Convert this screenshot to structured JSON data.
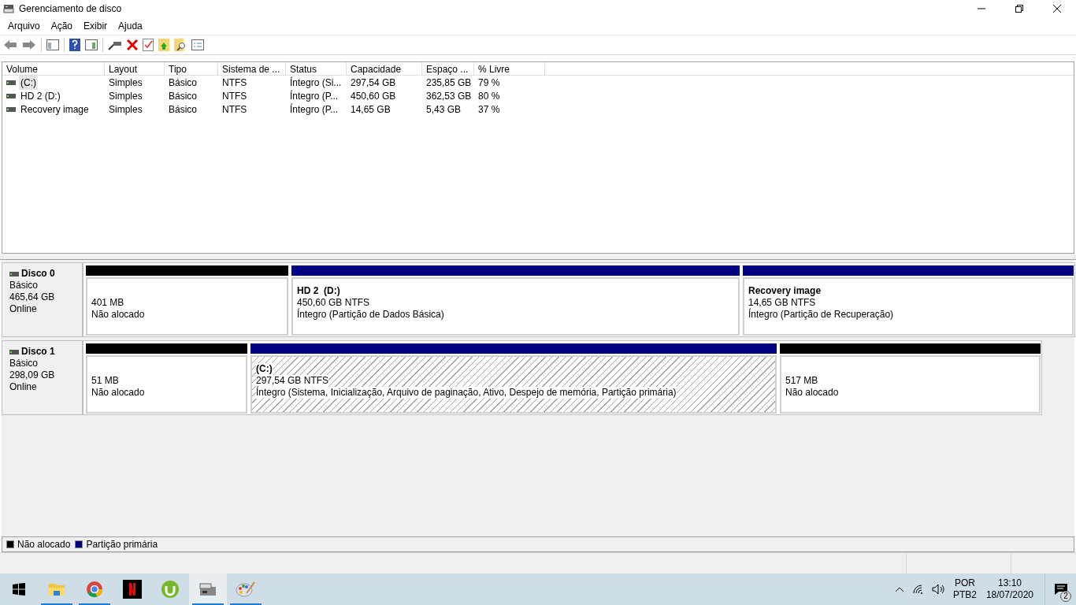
{
  "window": {
    "title": "Gerenciamento de disco"
  },
  "menu": [
    "Arquivo",
    "Ação",
    "Exibir",
    "Ajuda"
  ],
  "table": {
    "columns": [
      "Volume",
      "Layout",
      "Tipo",
      "Sistema de ...",
      "Status",
      "Capacidade",
      "Espaço ...",
      "% Livre"
    ],
    "rows": [
      {
        "selected": true,
        "cells": [
          "(C:)",
          "Simples",
          "Básico",
          "NTFS",
          "Íntegro (Si...",
          "297,54 GB",
          "235,85 GB",
          "79 %"
        ]
      },
      {
        "selected": false,
        "cells": [
          "HD 2 (D:)",
          "Simples",
          "Básico",
          "NTFS",
          "Íntegro (P...",
          "450,60 GB",
          "362,53 GB",
          "80 %"
        ]
      },
      {
        "selected": false,
        "cells": [
          "Recovery image",
          "Simples",
          "Básico",
          "NTFS",
          "Íntegro (P...",
          "14,65 GB",
          "5,43 GB",
          "37 %"
        ]
      }
    ]
  },
  "disks": [
    {
      "name": "Disco 0",
      "type": "Básico",
      "size": "465,64 GB",
      "state": "Online",
      "partitions": [
        {
          "kind": "unallocated",
          "selected": false,
          "size": "401 MB",
          "status": "Não alocado"
        },
        {
          "kind": "primary",
          "selected": false,
          "title": "HD 2  (D:)",
          "size": "450,60 GB NTFS",
          "status": "Íntegro (Partição de Dados Básica)"
        },
        {
          "kind": "primary",
          "selected": false,
          "title": "Recovery image",
          "size": "14,65 GB NTFS",
          "status": "Íntegro (Partição de Recuperação)"
        }
      ]
    },
    {
      "name": "Disco 1",
      "type": "Básico",
      "size": "298,09 GB",
      "state": "Online",
      "partitions": [
        {
          "kind": "unallocated",
          "selected": false,
          "size": "51 MB",
          "status": "Não alocado"
        },
        {
          "kind": "primary",
          "selected": true,
          "title": "(C:)",
          "size": "297,54 GB NTFS",
          "status": "Íntegro (Sistema, Inicialização, Arquivo de paginação, Ativo, Despejo de memória, Partição primária)"
        },
        {
          "kind": "unallocated",
          "selected": false,
          "size": "517 MB",
          "status": "Não alocado"
        }
      ]
    }
  ],
  "legend": [
    {
      "kind": "unallocated",
      "label": "Não alocado"
    },
    {
      "kind": "primary",
      "label": "Partição primária"
    }
  ],
  "taskbar": {
    "apps": [
      {
        "kind": "folder",
        "running": true,
        "active": false
      },
      {
        "kind": "browser",
        "running": true,
        "active": false
      },
      {
        "kind": "video",
        "running": false,
        "active": false
      },
      {
        "kind": "torrent",
        "running": false,
        "active": false
      },
      {
        "kind": "disk",
        "running": true,
        "active": true
      },
      {
        "kind": "paint",
        "running": true,
        "active": false
      }
    ],
    "language": [
      "POR",
      "PTB2"
    ],
    "time": "13:10",
    "date": "18/07/2020",
    "notifications": "2"
  }
}
